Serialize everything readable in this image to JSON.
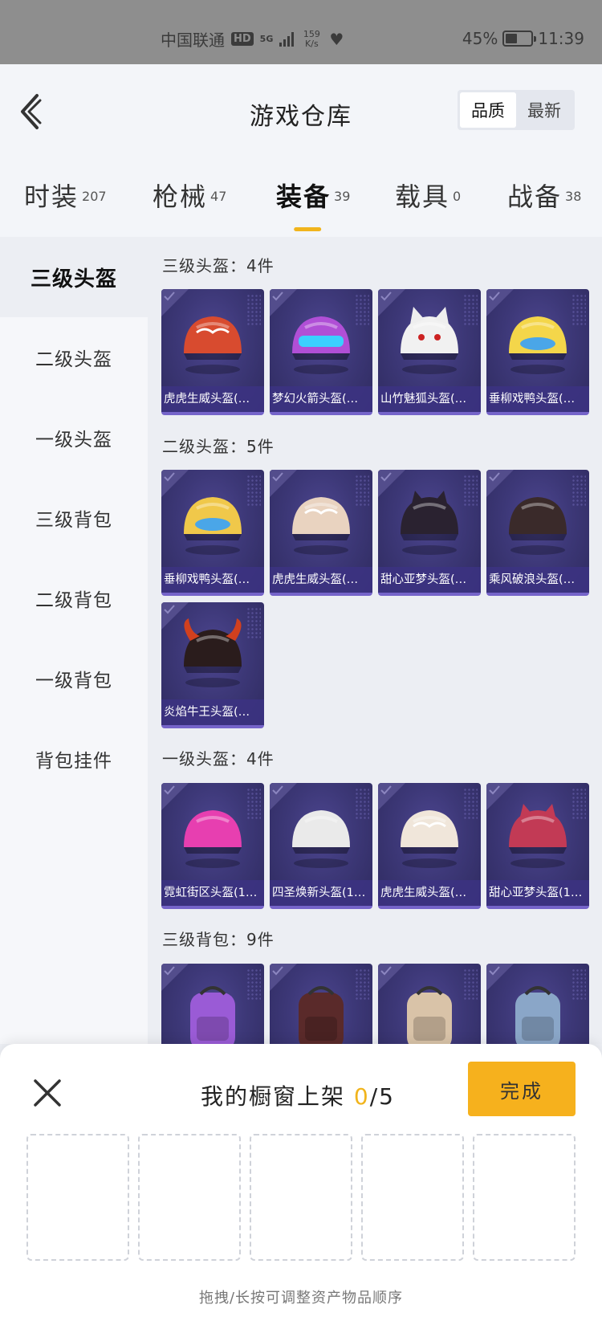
{
  "status_bar": {
    "carrier": "中国联通",
    "hd": "HD",
    "network": "5G",
    "speed_value": "159",
    "speed_unit": "K/s",
    "battery": "45%",
    "time": "11:39"
  },
  "header": {
    "title": "游戏仓库",
    "sort_options": [
      "品质",
      "最新"
    ],
    "active_sort": "品质"
  },
  "tabs": [
    {
      "label": "时装",
      "count": "207"
    },
    {
      "label": "枪械",
      "count": "47"
    },
    {
      "label": "装备",
      "count": "39"
    },
    {
      "label": "载具",
      "count": "0"
    },
    {
      "label": "战备",
      "count": "38"
    }
  ],
  "active_tab": "装备",
  "sidebar": {
    "items": [
      "三级头盔",
      "二级头盔",
      "一级头盔",
      "三级背包",
      "二级背包",
      "一级背包",
      "背包挂件"
    ],
    "active": "三级头盔"
  },
  "sections": [
    {
      "title": "三级头盔：4件",
      "items": [
        {
          "name": "虎虎生威头盔(…",
          "icon": "tiger-helmet-icon",
          "color": "#d84b2f"
        },
        {
          "name": "梦幻火箭头盔(…",
          "icon": "rocket-helmet-icon",
          "color": "#b04fd6"
        },
        {
          "name": "山竹魅狐头盔(…",
          "icon": "fox-mask-helmet-icon",
          "color": "#f1f1f1"
        },
        {
          "name": "垂柳戏鸭头盔(…",
          "icon": "duck-helmet-icon",
          "color": "#f4d64a"
        }
      ]
    },
    {
      "title": "二级头盔：5件",
      "items": [
        {
          "name": "垂柳戏鸭头盔(…",
          "icon": "duck-helmet-icon",
          "color": "#f0c84a"
        },
        {
          "name": "虎虎生威头盔(…",
          "icon": "tiger-helmet-icon",
          "color": "#e9d3c0"
        },
        {
          "name": "甜心亚梦头盔(…",
          "icon": "cat-ear-helmet-icon",
          "color": "#2a2230"
        },
        {
          "name": "乘风破浪头盔(…",
          "icon": "wave-helmet-icon",
          "color": "#3a2a2a"
        },
        {
          "name": "炎焰牛王头盔(…",
          "icon": "bull-horn-helmet-icon",
          "color": "#2a1c1c"
        }
      ]
    },
    {
      "title": "一级头盔：4件",
      "items": [
        {
          "name": "霓虹街区头盔(1…",
          "icon": "neon-helmet-icon",
          "color": "#e73fb0"
        },
        {
          "name": "四圣焕新头盔(1…",
          "icon": "white-helmet-icon",
          "color": "#eaeaea"
        },
        {
          "name": "虎虎生威头盔(…",
          "icon": "tiger-helmet-icon",
          "color": "#f0e6da"
        },
        {
          "name": "甜心亚梦头盔(1…",
          "icon": "cat-ear-helmet-icon",
          "color": "#c23a55"
        }
      ]
    },
    {
      "title": "三级背包：9件",
      "items": [
        {
          "name": "",
          "icon": "monster-backpack-icon",
          "color": "#9a5bd6"
        },
        {
          "name": "",
          "icon": "demon-backpack-icon",
          "color": "#5a2a2a"
        },
        {
          "name": "",
          "icon": "striped-backpack-icon",
          "color": "#d9c3a8"
        },
        {
          "name": "",
          "icon": "camo-backpack-icon",
          "color": "#8aa6c8"
        }
      ]
    }
  ],
  "showcase": {
    "title_prefix": "我的橱窗上架",
    "current": "0",
    "max": "/5",
    "done_label": "完成",
    "slot_count": 5,
    "hint": "拖拽/长按可调整资产物品顺序"
  },
  "colors": {
    "accent": "#f6b11d",
    "card_bg": "#3d3878",
    "card_label_bg": "#3c3282",
    "status_bar": "#8e8e8e"
  }
}
